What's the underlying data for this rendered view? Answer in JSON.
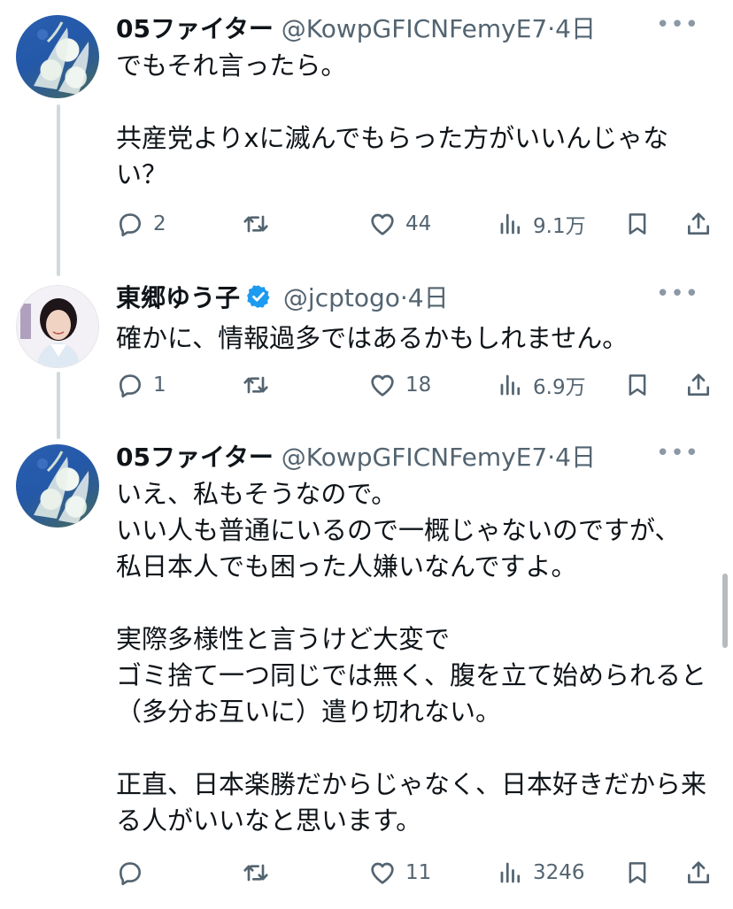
{
  "tweets": [
    {
      "name": "05ファイター",
      "handle": "@KowpGFICNFemyE7",
      "sep": "·",
      "time": "4日",
      "text": "でもそれ言ったら。\n\n共産党よりxに滅んでもらった方がいいんじゃない？",
      "replies": "2",
      "retweets": "",
      "likes": "44",
      "views": "9.1万",
      "verified": false
    },
    {
      "name": "東郷ゆう子",
      "handle": "@jcptogo",
      "sep": "·",
      "time": "4日",
      "text": "確かに、情報過多ではあるかもしれません。",
      "replies": "1",
      "retweets": "",
      "likes": "18",
      "views": "6.9万",
      "verified": true
    },
    {
      "name": "05ファイター",
      "handle": "@KowpGFICNFemyE7",
      "sep": "·",
      "time": "4日",
      "text": "いえ、私もそうなので。\nいい人も普通にいるので一概じゃないのですが、\n私日本人でも困った人嫌いなんですよ。\n\n実際多様性と言うけど大変で\nゴミ捨て一つ同じでは無く、腹を立て始められると（多分お互いに）遣り切れない。\n\n正直、日本楽勝だからじゃなく、日本好きだから来る人がいいなと思います。",
      "replies": "",
      "retweets": "",
      "likes": "11",
      "views": "3246",
      "verified": false
    }
  ],
  "colors": {
    "text": "#0f1419",
    "secondary": "#536471",
    "verified": "#1d9bf0",
    "thread_line": "#cfd9de"
  },
  "icons": [
    "reply-icon",
    "retweet-icon",
    "like-icon",
    "views-icon",
    "bookmark-icon",
    "share-icon",
    "more-icon",
    "verified-badge-icon"
  ]
}
